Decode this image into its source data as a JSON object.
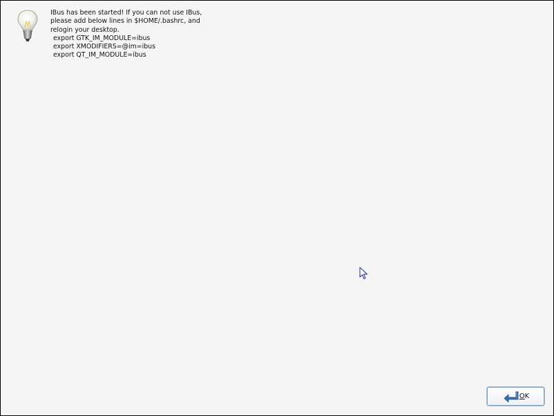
{
  "dialog": {
    "icon": "lightbulb-icon",
    "message_intro": "IBus has been started! If you can not use IBus, please add below lines in $HOME/.bashrc, and relogin your desktop.",
    "commands": [
      "export GTK_IM_MODULE=ibus",
      "export XMODIFIERS=@im=ibus",
      "export QT_IM_MODULE=ibus"
    ]
  },
  "ok_button": {
    "icon": "return-arrow-icon",
    "mnemonic": "O",
    "label_rest": "K"
  },
  "cursor": "mouse-pointer-icon",
  "colors": {
    "background": "#f5f5f5",
    "frame": "#000000",
    "button_border": "#7d9dc4",
    "arrow_icon": "#3a6fb0"
  }
}
